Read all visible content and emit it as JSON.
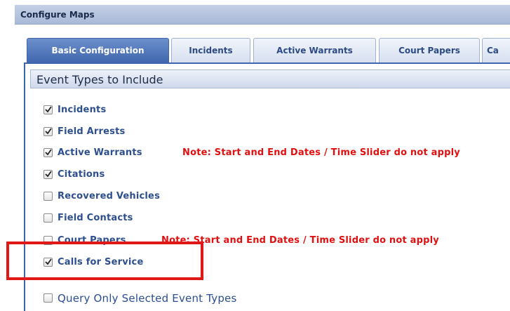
{
  "window": {
    "title": "Configure Maps"
  },
  "tabs": [
    {
      "label": "Basic Configuration",
      "active": true
    },
    {
      "label": "Incidents",
      "active": false
    },
    {
      "label": "Active Warrants",
      "active": false
    },
    {
      "label": "Court Papers",
      "active": false
    },
    {
      "label": "Ca",
      "active": false
    }
  ],
  "section": {
    "title": "Event Types to Include"
  },
  "options": [
    {
      "label": "Incidents",
      "checked": true,
      "note": ""
    },
    {
      "label": "Field Arrests",
      "checked": true,
      "note": ""
    },
    {
      "label": "Active Warrants",
      "checked": true,
      "note": "Note: Start and End Dates / Time Slider do not apply"
    },
    {
      "label": "Citations",
      "checked": true,
      "note": ""
    },
    {
      "label": "Recovered Vehicles",
      "checked": false,
      "note": ""
    },
    {
      "label": "Field Contacts",
      "checked": false,
      "note": ""
    },
    {
      "label": "Court Papers",
      "checked": false,
      "note": "Note: Start and End Dates / Time Slider do not apply"
    },
    {
      "label": "Calls for Service",
      "checked": true,
      "note": ""
    }
  ],
  "query_option": {
    "label": "Query Only Selected Event Types",
    "checked": false
  },
  "colors": {
    "active_tab": "#3f66ad",
    "label_text": "#2d4f8f",
    "note_text": "#e01010",
    "highlight_border": "#e01818"
  },
  "icons": {
    "checkmark": "checkmark-icon"
  }
}
